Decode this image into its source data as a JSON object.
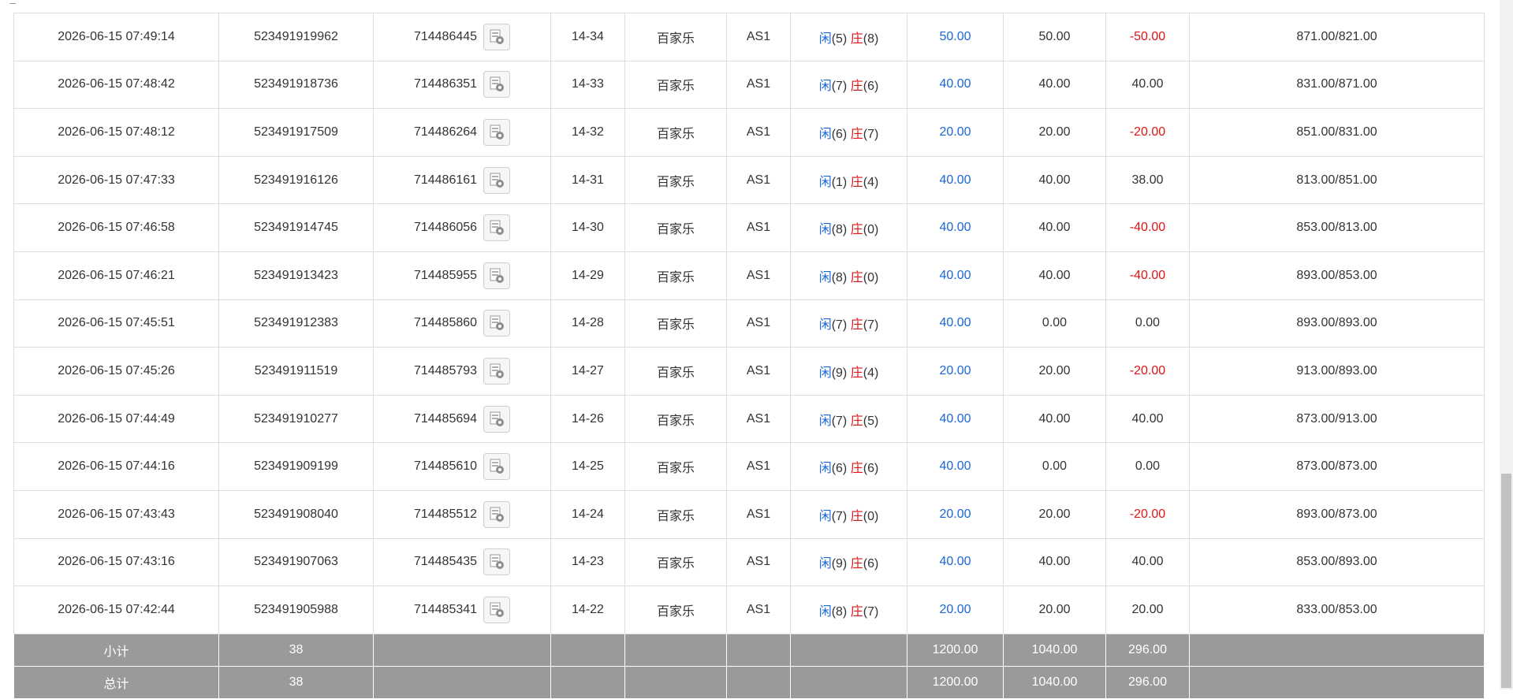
{
  "table": {
    "rows": [
      {
        "time": "2026-06-15 07:49:14",
        "order_no": "523491919962",
        "round_no": "714486445",
        "shoe": "14-34",
        "game": "百家乐",
        "table": "AS1",
        "player_label": "闲",
        "player_pts": "(5)",
        "banker_label": "庄",
        "banker_pts": "(8)",
        "bet": "50.00",
        "valid_bet": "50.00",
        "win_loss": "-50.00",
        "win_loss_neg": true,
        "balance": "871.00/821.00"
      },
      {
        "time": "2026-06-15 07:48:42",
        "order_no": "523491918736",
        "round_no": "714486351",
        "shoe": "14-33",
        "game": "百家乐",
        "table": "AS1",
        "player_label": "闲",
        "player_pts": "(7)",
        "banker_label": "庄",
        "banker_pts": "(6)",
        "bet": "40.00",
        "valid_bet": "40.00",
        "win_loss": "40.00",
        "win_loss_neg": false,
        "balance": "831.00/871.00"
      },
      {
        "time": "2026-06-15 07:48:12",
        "order_no": "523491917509",
        "round_no": "714486264",
        "shoe": "14-32",
        "game": "百家乐",
        "table": "AS1",
        "player_label": "闲",
        "player_pts": "(6)",
        "banker_label": "庄",
        "banker_pts": "(7)",
        "bet": "20.00",
        "valid_bet": "20.00",
        "win_loss": "-20.00",
        "win_loss_neg": true,
        "balance": "851.00/831.00"
      },
      {
        "time": "2026-06-15 07:47:33",
        "order_no": "523491916126",
        "round_no": "714486161",
        "shoe": "14-31",
        "game": "百家乐",
        "table": "AS1",
        "player_label": "闲",
        "player_pts": "(1)",
        "banker_label": "庄",
        "banker_pts": "(4)",
        "bet": "40.00",
        "valid_bet": "40.00",
        "win_loss": "38.00",
        "win_loss_neg": false,
        "balance": "813.00/851.00"
      },
      {
        "time": "2026-06-15 07:46:58",
        "order_no": "523491914745",
        "round_no": "714486056",
        "shoe": "14-30",
        "game": "百家乐",
        "table": "AS1",
        "player_label": "闲",
        "player_pts": "(8)",
        "banker_label": "庄",
        "banker_pts": "(0)",
        "bet": "40.00",
        "valid_bet": "40.00",
        "win_loss": "-40.00",
        "win_loss_neg": true,
        "balance": "853.00/813.00"
      },
      {
        "time": "2026-06-15 07:46:21",
        "order_no": "523491913423",
        "round_no": "714485955",
        "shoe": "14-29",
        "game": "百家乐",
        "table": "AS1",
        "player_label": "闲",
        "player_pts": "(8)",
        "banker_label": "庄",
        "banker_pts": "(0)",
        "bet": "40.00",
        "valid_bet": "40.00",
        "win_loss": "-40.00",
        "win_loss_neg": true,
        "balance": "893.00/853.00"
      },
      {
        "time": "2026-06-15 07:45:51",
        "order_no": "523491912383",
        "round_no": "714485860",
        "shoe": "14-28",
        "game": "百家乐",
        "table": "AS1",
        "player_label": "闲",
        "player_pts": "(7)",
        "banker_label": "庄",
        "banker_pts": "(7)",
        "bet": "40.00",
        "valid_bet": "0.00",
        "win_loss": "0.00",
        "win_loss_neg": false,
        "balance": "893.00/893.00"
      },
      {
        "time": "2026-06-15 07:45:26",
        "order_no": "523491911519",
        "round_no": "714485793",
        "shoe": "14-27",
        "game": "百家乐",
        "table": "AS1",
        "player_label": "闲",
        "player_pts": "(9)",
        "banker_label": "庄",
        "banker_pts": "(4)",
        "bet": "20.00",
        "valid_bet": "20.00",
        "win_loss": "-20.00",
        "win_loss_neg": true,
        "balance": "913.00/893.00"
      },
      {
        "time": "2026-06-15 07:44:49",
        "order_no": "523491910277",
        "round_no": "714485694",
        "shoe": "14-26",
        "game": "百家乐",
        "table": "AS1",
        "player_label": "闲",
        "player_pts": "(7)",
        "banker_label": "庄",
        "banker_pts": "(5)",
        "bet": "40.00",
        "valid_bet": "40.00",
        "win_loss": "40.00",
        "win_loss_neg": false,
        "balance": "873.00/913.00"
      },
      {
        "time": "2026-06-15 07:44:16",
        "order_no": "523491909199",
        "round_no": "714485610",
        "shoe": "14-25",
        "game": "百家乐",
        "table": "AS1",
        "player_label": "闲",
        "player_pts": "(6)",
        "banker_label": "庄",
        "banker_pts": "(6)",
        "bet": "40.00",
        "valid_bet": "0.00",
        "win_loss": "0.00",
        "win_loss_neg": false,
        "balance": "873.00/873.00"
      },
      {
        "time": "2026-06-15 07:43:43",
        "order_no": "523491908040",
        "round_no": "714485512",
        "shoe": "14-24",
        "game": "百家乐",
        "table": "AS1",
        "player_label": "闲",
        "player_pts": "(7)",
        "banker_label": "庄",
        "banker_pts": "(0)",
        "bet": "20.00",
        "valid_bet": "20.00",
        "win_loss": "-20.00",
        "win_loss_neg": true,
        "balance": "893.00/873.00"
      },
      {
        "time": "2026-06-15 07:43:16",
        "order_no": "523491907063",
        "round_no": "714485435",
        "shoe": "14-23",
        "game": "百家乐",
        "table": "AS1",
        "player_label": "闲",
        "player_pts": "(9)",
        "banker_label": "庄",
        "banker_pts": "(6)",
        "bet": "40.00",
        "valid_bet": "40.00",
        "win_loss": "40.00",
        "win_loss_neg": false,
        "balance": "853.00/893.00"
      },
      {
        "time": "2026-06-15 07:42:44",
        "order_no": "523491905988",
        "round_no": "714485341",
        "shoe": "14-22",
        "game": "百家乐",
        "table": "AS1",
        "player_label": "闲",
        "player_pts": "(8)",
        "banker_label": "庄",
        "banker_pts": "(7)",
        "bet": "20.00",
        "valid_bet": "20.00",
        "win_loss": "20.00",
        "win_loss_neg": false,
        "balance": "833.00/853.00"
      }
    ],
    "subtotal": {
      "label": "小计",
      "count": "38",
      "bet": "1200.00",
      "valid_bet": "1040.00",
      "win_loss": "296.00"
    },
    "total": {
      "label": "总计",
      "count": "38",
      "bet": "1200.00",
      "valid_bet": "1040.00",
      "win_loss": "296.00"
    }
  },
  "icons": {
    "result_image": "result-picture-icon"
  },
  "colors": {
    "player": "#1a66d9",
    "banker": "#e01515",
    "bet": "#1a66d9",
    "negative": "#e01515",
    "summary_bg": "#9a9a9a"
  }
}
